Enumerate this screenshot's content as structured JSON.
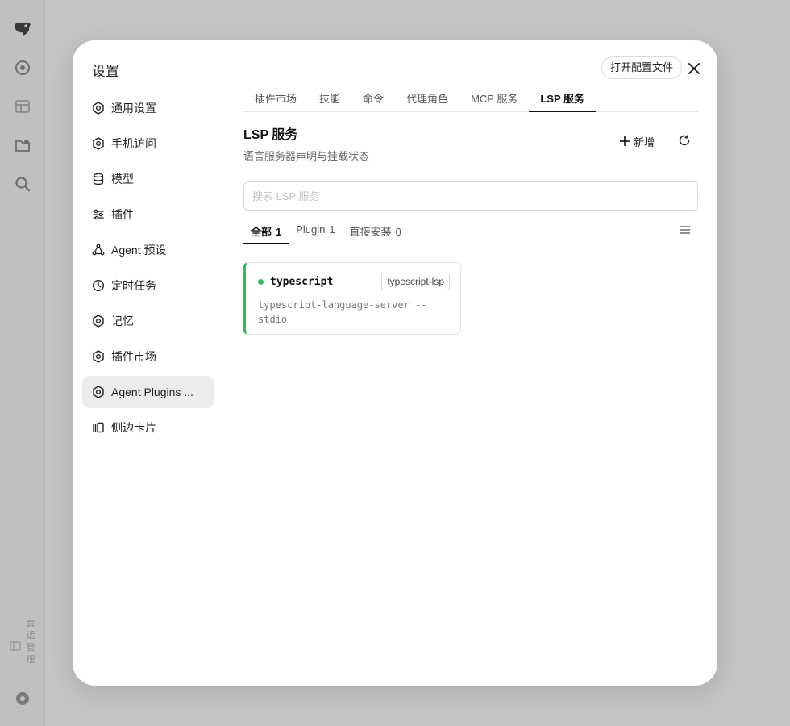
{
  "background_rail": {
    "vertical_text": "会话管理"
  },
  "modal": {
    "title": "设置",
    "open_config_label": "打开配置文件"
  },
  "sidebar": {
    "items": [
      {
        "label": "通用设置",
        "icon": "gear-icon"
      },
      {
        "label": "手机访问",
        "icon": "gear-icon"
      },
      {
        "label": "模型",
        "icon": "database-icon"
      },
      {
        "label": "插件",
        "icon": "sliders-icon"
      },
      {
        "label": "Agent 预设",
        "icon": "agent-icon"
      },
      {
        "label": "定时任务",
        "icon": "clock-icon"
      },
      {
        "label": "记忆",
        "icon": "gear-icon"
      },
      {
        "label": "插件市场",
        "icon": "gear-icon"
      },
      {
        "label": "Agent Plugins ...",
        "icon": "gear-icon",
        "active": true
      },
      {
        "label": "侧边卡片",
        "icon": "cards-icon"
      }
    ]
  },
  "tabs": [
    {
      "label": "插件市场"
    },
    {
      "label": "技能"
    },
    {
      "label": "命令"
    },
    {
      "label": "代理角色"
    },
    {
      "label": "MCP 服务"
    },
    {
      "label": "LSP 服务",
      "active": true
    }
  ],
  "section": {
    "title": "LSP 服务",
    "subtitle": "语言服务器声明与挂载状态",
    "add_label": "新增"
  },
  "search": {
    "placeholder": "搜索 LSP 服务",
    "value": ""
  },
  "filters": [
    {
      "label": "全部",
      "count": "1",
      "active": true
    },
    {
      "label": "Plugin",
      "count": "1"
    },
    {
      "label": "直接安装",
      "count": "0"
    }
  ],
  "servers": [
    {
      "name": "typescript",
      "tag": "typescript-lsp",
      "command": "typescript-language-server --stdio",
      "status": "running"
    }
  ],
  "colors": {
    "status_green": "#2fbd59",
    "active_item_bg": "#ececee",
    "overlay_bg": "#c4c4c4"
  }
}
